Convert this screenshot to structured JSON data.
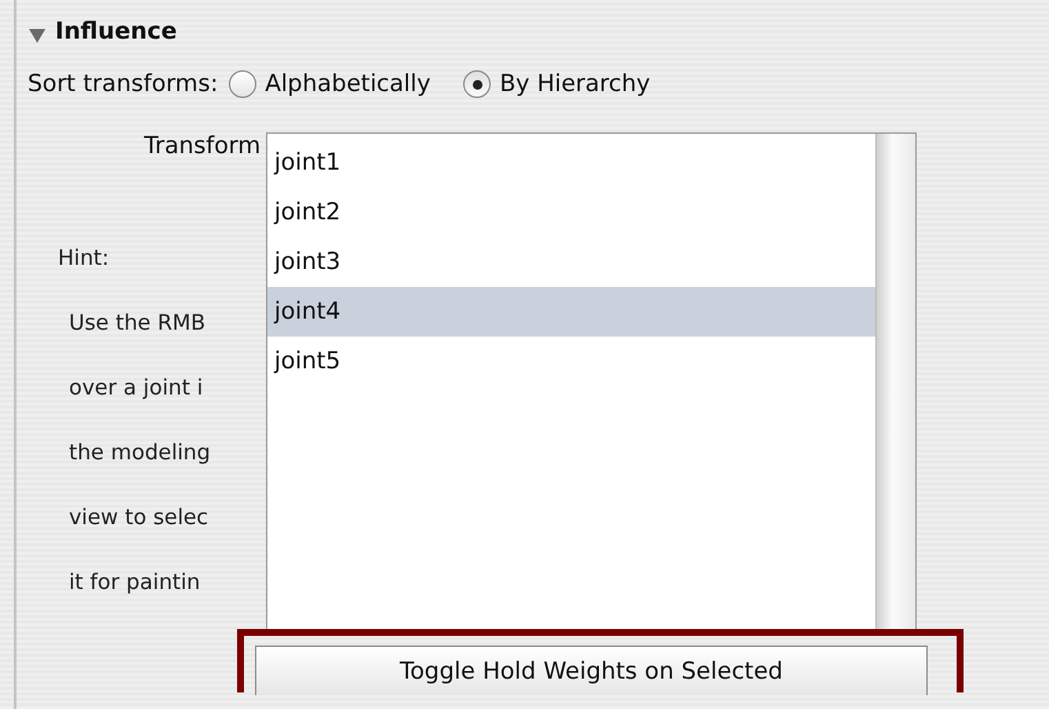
{
  "section": {
    "title": "Influence",
    "expanded": true
  },
  "sort": {
    "label": "Sort transforms:",
    "options": [
      {
        "label": "Alphabetically",
        "selected": false
      },
      {
        "label": "By Hierarchy",
        "selected": true
      }
    ]
  },
  "transform_label": "Transform",
  "hint_lines": [
    "Hint:",
    "Use the RMB",
    "over a joint i",
    "the modeling",
    "view to selec",
    "it for paintin"
  ],
  "transforms": [
    {
      "label": "joint1",
      "selected": false
    },
    {
      "label": "joint2",
      "selected": false
    },
    {
      "label": "joint3",
      "selected": false
    },
    {
      "label": "joint4",
      "selected": true
    },
    {
      "label": "joint5",
      "selected": false
    }
  ],
  "button": "Toggle Hold Weights on Selected"
}
